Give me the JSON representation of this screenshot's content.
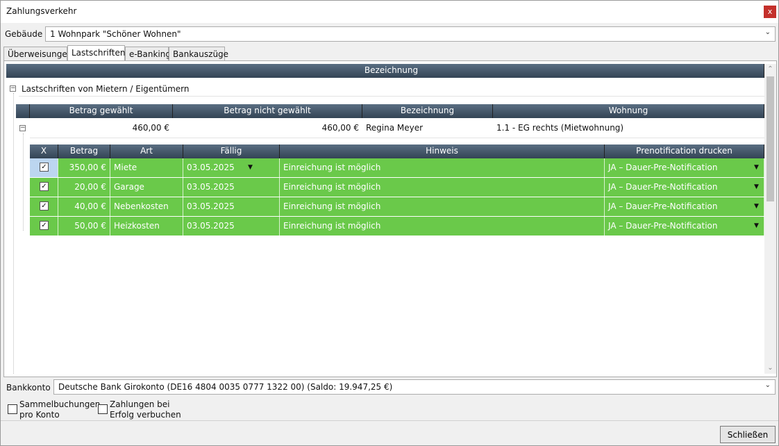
{
  "window": {
    "title": "Zahlungsverkehr",
    "close_label": "x"
  },
  "building": {
    "label": "Gebäude",
    "value": "1 Wohnpark \"Schöner Wohnen\""
  },
  "tabs": [
    {
      "label": "Überweisungen",
      "active": false
    },
    {
      "label": "Lastschriften",
      "active": true
    },
    {
      "label": "e-Banking",
      "active": false
    },
    {
      "label": "Bankauszüge",
      "active": false
    }
  ],
  "outer_grid": {
    "header": "Bezeichnung",
    "group_label": "Lastschriften von Mietern / Eigentümern"
  },
  "tenant_grid": {
    "headers": [
      "Betrag gewählt",
      "Betrag nicht gewählt",
      "Bezeichnung",
      "Wohnung"
    ],
    "row": {
      "selected_amount": "460,00 €",
      "unselected_amount": "460,00 €",
      "name": "Regina Meyer",
      "unit": "1.1 - EG rechts (Mietwohnung)"
    }
  },
  "items_grid": {
    "headers": [
      "X",
      "Betrag",
      "Art",
      "Fällig",
      "Hinweis",
      "Prenotification drucken"
    ],
    "rows": [
      {
        "checked": "✓",
        "amount": "350,00 €",
        "type": "Miete",
        "due": "03.05.2025",
        "note": "Einreichung ist möglich",
        "prenotification": "JA – Dauer-Pre-Notification"
      },
      {
        "checked": "✓",
        "amount": "20,00 €",
        "type": "Garage",
        "due": "03.05.2025",
        "note": "Einreichung ist möglich",
        "prenotification": "JA – Dauer-Pre-Notification"
      },
      {
        "checked": "✓",
        "amount": "40,00 €",
        "type": "Nebenkosten",
        "due": "03.05.2025",
        "note": "Einreichung ist möglich",
        "prenotification": "JA – Dauer-Pre-Notification"
      },
      {
        "checked": "✓",
        "amount": "50,00 €",
        "type": "Heizkosten",
        "due": "03.05.2025",
        "note": "Einreichung ist möglich",
        "prenotification": "JA – Dauer-Pre-Notification"
      }
    ]
  },
  "bank_account": {
    "label": "Bankkonto",
    "value": "Deutsche Bank Girokonto (DE16 4804 0035 0777 1322 00) (Saldo: 19.947,25 €)"
  },
  "options": {
    "collective_line1": "Sammelbuchungen",
    "collective_line2": "pro Konto",
    "on_success_line1": "Zahlungen bei",
    "on_success_line2": "Erfolg verbuchen"
  },
  "footer": {
    "close_button": "Schließen"
  },
  "colors": {
    "header_dark": "#334455",
    "row_green": "#6ac94a",
    "close_red": "#c4302b"
  }
}
